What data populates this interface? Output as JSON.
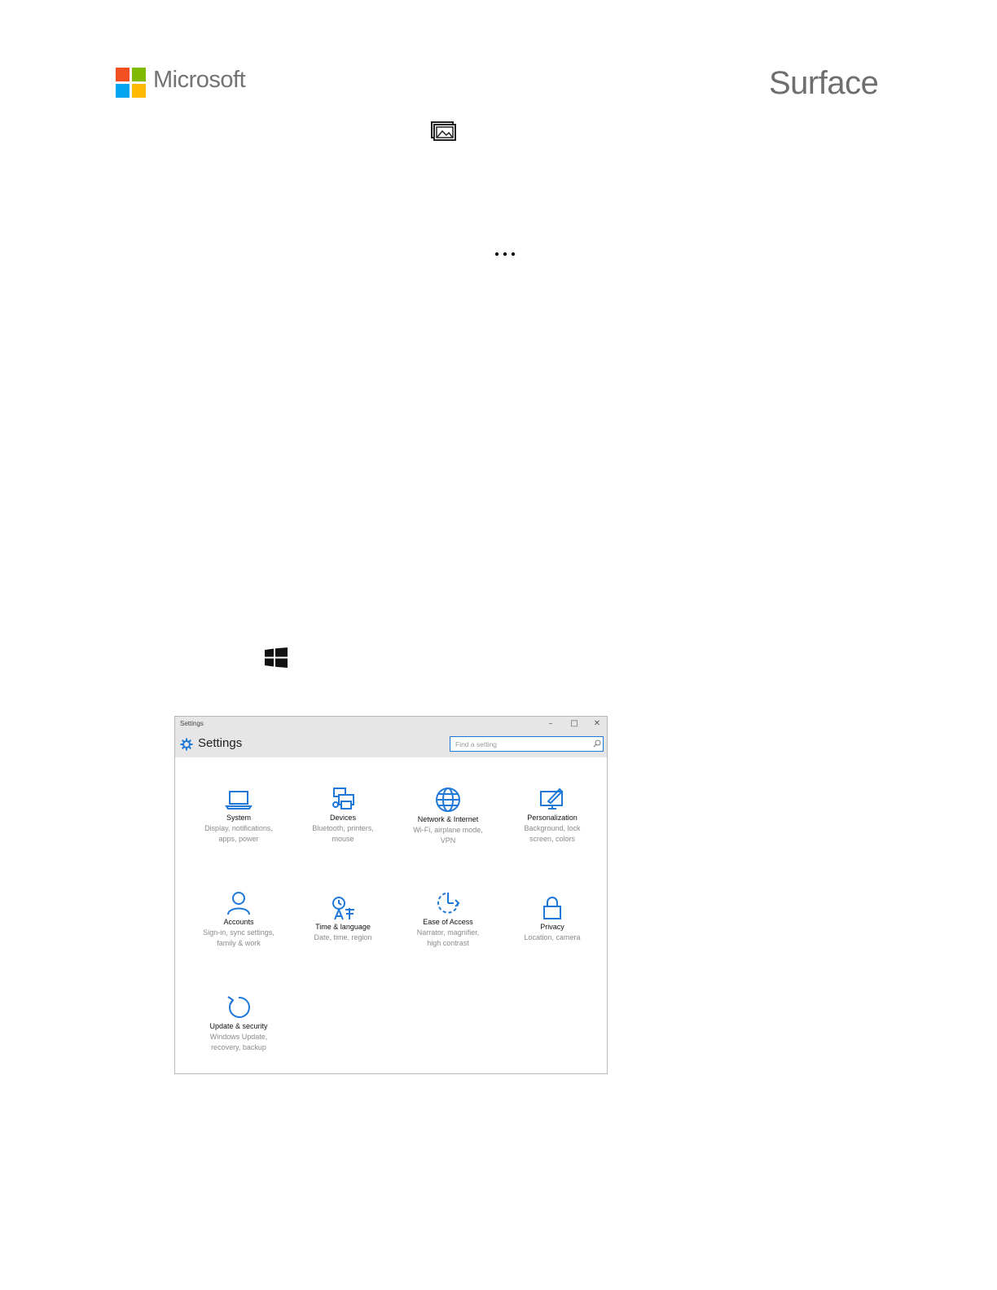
{
  "header": {
    "brand_left": "Microsoft",
    "brand_right": "Surface",
    "logo_colors": [
      "#f25022",
      "#7fba00",
      "#00a4ef",
      "#ffb900"
    ]
  },
  "inline_icons": [
    "gallery-icon",
    "more-icon",
    "windows-logo-icon"
  ],
  "settings_window": {
    "titlebar_text": "Settings",
    "controls": {
      "minimize": "–",
      "maximize": "□",
      "close": "✕"
    },
    "app_title": "Settings",
    "search_placeholder": "Find a setting",
    "accent": "#1e78d7",
    "tiles": [
      {
        "label": "System",
        "desc_line1": "Display, notifications,",
        "desc_line2": "apps, power",
        "icon": "laptop-icon"
      },
      {
        "label": "Devices",
        "desc_line1": "Bluetooth, printers,",
        "desc_line2": "mouse",
        "icon": "devices-icon"
      },
      {
        "label": "Network & Internet",
        "desc_line1": "Wi-Fi, airplane mode,",
        "desc_line2": "VPN",
        "icon": "globe-icon"
      },
      {
        "label": "Personalization",
        "desc_line1": "Background, lock",
        "desc_line2": "screen, colors",
        "icon": "personalization-icon"
      },
      {
        "label": "Accounts",
        "desc_line1": "Sign-in, sync settings,",
        "desc_line2": "family & work",
        "icon": "person-icon"
      },
      {
        "label": "Time & language",
        "desc_line1": "Date, time, region",
        "desc_line2": "",
        "icon": "time-language-icon"
      },
      {
        "label": "Ease of Access",
        "desc_line1": "Narrator, magnifier,",
        "desc_line2": "high contrast",
        "icon": "ease-of-access-icon"
      },
      {
        "label": "Privacy",
        "desc_line1": "Location, camera",
        "desc_line2": "",
        "icon": "lock-icon"
      },
      {
        "label": "Update & security",
        "desc_line1": "Windows Update,",
        "desc_line2": "recovery, backup",
        "icon": "refresh-icon"
      }
    ]
  }
}
